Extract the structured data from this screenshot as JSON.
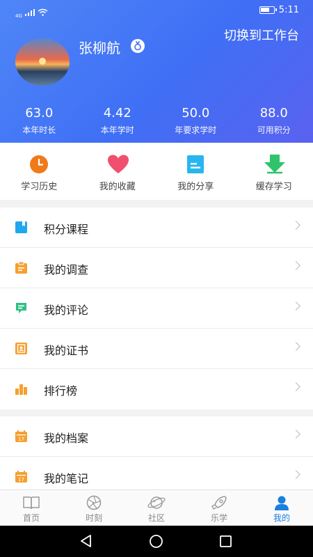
{
  "status_bar": {
    "carrier": "4G",
    "time": "5:11"
  },
  "profile": {
    "name": "张柳航",
    "switch_label": "切换到工作台",
    "stats": [
      {
        "value": "63.0",
        "label": "本年时长"
      },
      {
        "value": "4.42",
        "label": "本年学时"
      },
      {
        "value": "50.0",
        "label": "年要求学时"
      },
      {
        "value": "88.0",
        "label": "可用积分"
      }
    ]
  },
  "quick_actions": [
    {
      "label": "学习历史",
      "icon": "clock-icon",
      "color": "#f07a1a"
    },
    {
      "label": "我的收藏",
      "icon": "heart-icon",
      "color": "#f0506e"
    },
    {
      "label": "我的分享",
      "icon": "share-doc-icon",
      "color": "#28b6f0"
    },
    {
      "label": "缓存学习",
      "icon": "download-icon",
      "color": "#2fc46c"
    }
  ],
  "menu_group_1": [
    {
      "label": "积分课程",
      "icon": "bookmark-icon",
      "color": "#1fa8ee"
    },
    {
      "label": "我的调查",
      "icon": "clipboard-icon",
      "color": "#f5a030"
    },
    {
      "label": "我的评论",
      "icon": "comment-icon",
      "color": "#2fbf86"
    },
    {
      "label": "我的证书",
      "icon": "certificate-icon",
      "color": "#f5a030"
    },
    {
      "label": "排行榜",
      "icon": "ranking-icon",
      "color": "#f5a030"
    }
  ],
  "menu_group_2": [
    {
      "label": "我的档案",
      "icon": "calendar-icon",
      "color": "#f5a030"
    },
    {
      "label": "我的笔记",
      "icon": "calendar-icon",
      "color": "#f5a030"
    }
  ],
  "tabs": [
    {
      "label": "首页",
      "icon": "book-icon"
    },
    {
      "label": "时刻",
      "icon": "aperture-icon"
    },
    {
      "label": "社区",
      "icon": "planet-icon"
    },
    {
      "label": "乐学",
      "icon": "rocket-icon"
    },
    {
      "label": "我的",
      "icon": "person-icon",
      "active": true
    }
  ],
  "colors": {
    "header": "#4f86f7",
    "accent": "#1b7fe0"
  }
}
